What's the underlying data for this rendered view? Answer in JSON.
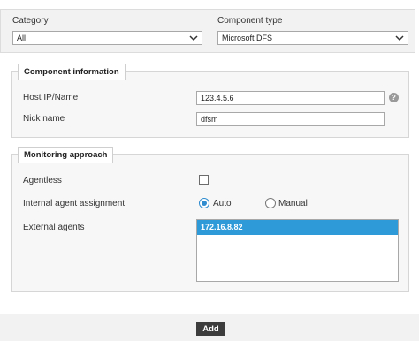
{
  "filters": {
    "category_label": "Category",
    "category_value": "All",
    "component_type_label": "Component type",
    "component_type_value": "Microsoft DFS"
  },
  "component_information": {
    "legend": "Component information",
    "host_label": "Host IP/Name",
    "host_value": "123.4.5.6",
    "help_glyph": "?",
    "nick_label": "Nick name",
    "nick_value": "dfsm"
  },
  "monitoring_approach": {
    "legend": "Monitoring approach",
    "agentless_label": "Agentless",
    "agentless_checked": false,
    "internal_agent_label": "Internal agent assignment",
    "options": [
      "Auto",
      "Manual"
    ],
    "selected_option": "Auto",
    "external_agents_label": "External agents",
    "external_agents": [
      "172.16.8.82"
    ]
  },
  "footer": {
    "add_label": "Add"
  },
  "colors": {
    "accent": "#2e8ccf",
    "selection": "#2e9ad8",
    "button": "#3d3d3d"
  }
}
